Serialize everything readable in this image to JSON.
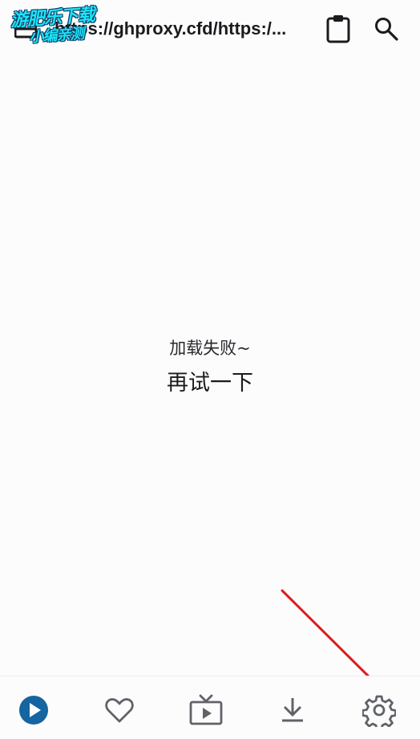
{
  "topbar": {
    "url_text": "https://ghproxy.cfd/https:/...",
    "menu_icon": "menu-icon",
    "clipboard_icon": "clipboard-icon",
    "search_icon": "search-icon"
  },
  "watermark": {
    "line1": "游肥乐下载",
    "line2": "小编亲测"
  },
  "error": {
    "message": "加载失败~",
    "retry_label": "再试一下"
  },
  "bottom_nav": {
    "items": [
      {
        "icon": "play-circle-icon",
        "active": true
      },
      {
        "icon": "heart-icon",
        "active": false
      },
      {
        "icon": "tv-icon",
        "active": false
      },
      {
        "icon": "download-icon",
        "active": false
      },
      {
        "icon": "settings-icon",
        "active": false
      }
    ]
  },
  "colors": {
    "accent": "#1565a0",
    "icon": "#5f6368",
    "arrow": "#e01b1b",
    "watermark": "#1ee4f5"
  }
}
